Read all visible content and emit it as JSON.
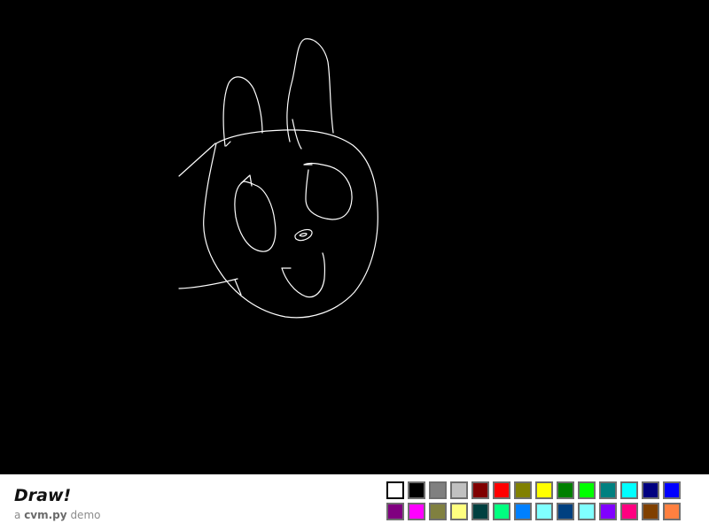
{
  "app": {
    "title": "Draw!",
    "subtitle_prefix": "a",
    "subtitle_brand": "cvm.py",
    "subtitle_suffix": "demo"
  },
  "canvas": {
    "background": "#000000",
    "stroke_color": "#ffffff"
  },
  "palette": {
    "selected_index": 0,
    "colors": [
      "#ffffff",
      "#000000",
      "#808080",
      "#c0c0c0",
      "#800000",
      "#ff0000",
      "#808000",
      "#ffff00",
      "#008000",
      "#00ff00",
      "#008080",
      "#00ffff",
      "#000080",
      "#0000ff",
      "#800080",
      "#ff00ff",
      "#808040",
      "#ffff80",
      "#004040",
      "#00ff80",
      "#0080ff",
      "#80ffff",
      "#004080",
      "#80ffff",
      "#8000ff",
      "#ff0080",
      "#804000",
      "#ff8040"
    ]
  }
}
